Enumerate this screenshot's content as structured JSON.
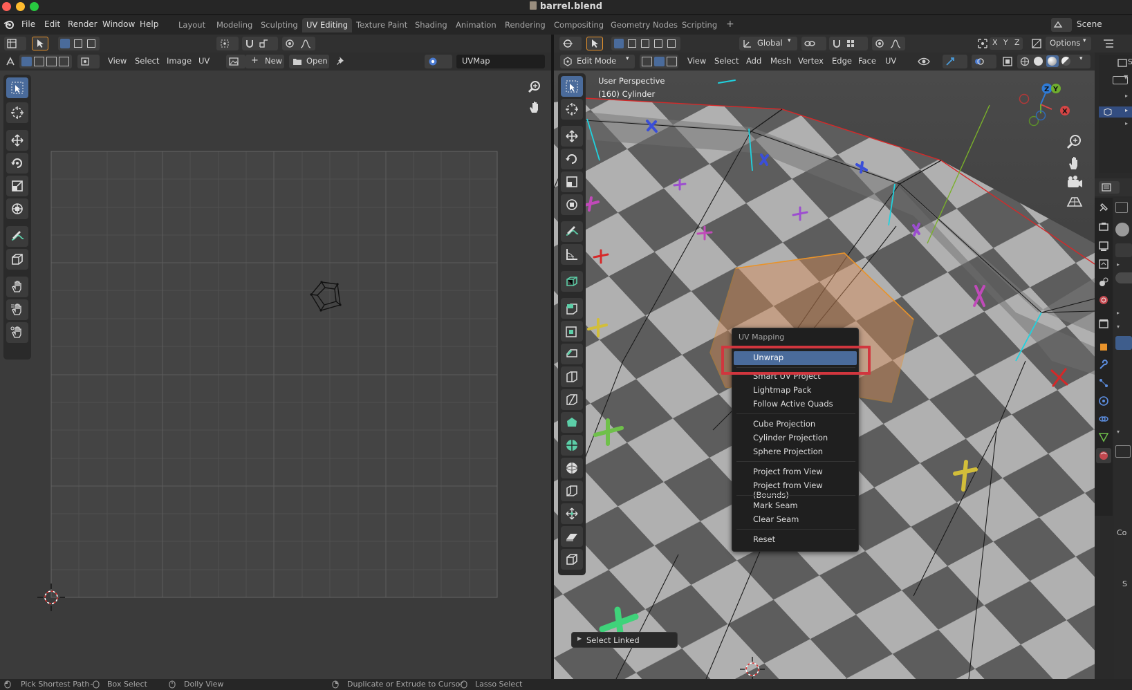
{
  "window": {
    "title": "barrel.blend"
  },
  "menubar": {
    "items": [
      "File",
      "Edit",
      "Render",
      "Window",
      "Help"
    ]
  },
  "workspaces": {
    "tabs": [
      "Layout",
      "Modeling",
      "Sculpting",
      "UV Editing",
      "Texture Paint",
      "Shading",
      "Animation",
      "Rendering",
      "Compositing",
      "Geometry Nodes",
      "Scripting"
    ],
    "active": "UV Editing",
    "add_label": "+"
  },
  "scene": {
    "label": "Scene"
  },
  "uv_editor": {
    "menus": [
      "View",
      "Select",
      "Image",
      "UV"
    ],
    "new_label": "New",
    "open_label": "Open",
    "uvmap_value": "UVMap"
  },
  "viewport": {
    "orientation_value": "Global",
    "options_label": "Options",
    "axis_labels": [
      "X",
      "Y",
      "Z"
    ],
    "mode_value": "Edit Mode",
    "menus": [
      "View",
      "Select",
      "Add",
      "Mesh",
      "Vertex",
      "Edge",
      "Face",
      "UV"
    ],
    "overlay_line1": "User Perspective",
    "overlay_line2": "(160) Cylinder",
    "gizmo_labels": [
      "Z",
      "Y",
      "X"
    ],
    "last_op_label": "Select Linked"
  },
  "uv_menu": {
    "title": "UV Mapping",
    "items": [
      "Unwrap",
      "Smart UV Project",
      "Lightmap Pack",
      "Follow Active Quads",
      "Cube Projection",
      "Cylinder Projection",
      "Sphere Projection",
      "Project from View",
      "Project from View (Bounds)",
      "Mark Seam",
      "Clear Seam",
      "Reset"
    ],
    "highlighted": "Unwrap"
  },
  "right_panel": {
    "labels": [
      "S",
      "Co",
      "S"
    ]
  },
  "status_bar": {
    "items": [
      "Pick Shortest Path",
      "Box Select",
      "Dolly View",
      "Duplicate or Extrude to Cursor",
      "Lasso Select"
    ]
  },
  "colors": {
    "accent": "#4a6b9b",
    "highlight_box": "#d1363e",
    "selection_orange": "#e8932b",
    "seam_cyan": "#1fd3e0",
    "boundary_red": "#d62828"
  }
}
